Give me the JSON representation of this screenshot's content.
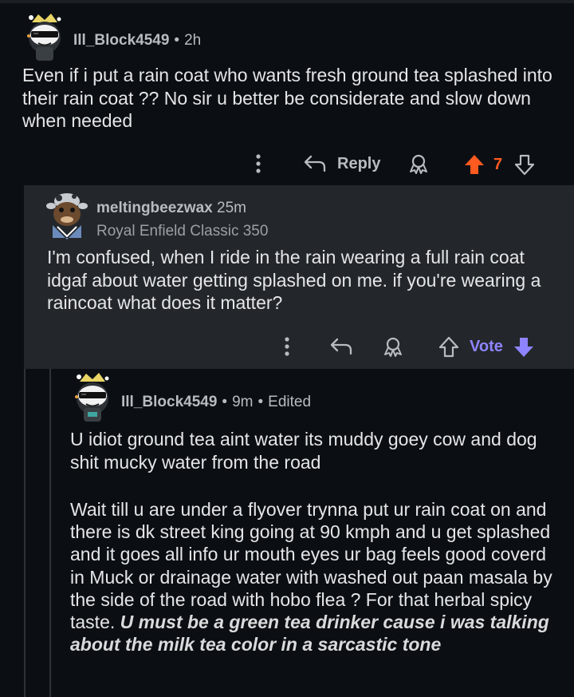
{
  "comments": [
    {
      "username": "Ill_Block4549",
      "time": "2h",
      "body": "Even if i put a rain coat who wants fresh ground tea splashed into their rain coat ?? No sir u better be considerate and slow down when needed",
      "actions": {
        "reply_label": "Reply",
        "score": "7"
      },
      "colors": {
        "upvote_active": "#ff5a1f"
      }
    },
    {
      "username": "meltingbeezwax",
      "time": "25m",
      "flair": "Royal Enfield Classic 350",
      "body": "I'm confused, when I ride in the rain wearing a full rain coat idgaf about water getting splashed on me. if you're wearing a raincoat what does it matter?",
      "actions": {
        "vote_label": "Vote"
      },
      "colors": {
        "vote_accent": "#8e84ff"
      }
    },
    {
      "username": "Ill_Block4549",
      "time": "9m",
      "edited": "Edited",
      "p1": "U idiot ground tea aint water its muddy goey cow and dog shit mucky water from the road",
      "p2_plain": "Wait till u are under a flyover trynna put ur rain coat on and there is dk street king going at 90 kmph and u get splashed and it goes all info ur mouth eyes ur bag feels good coverd in Muck or drainage water with washed out paan masala by the side of the road with hobo flea ? For that herbal spicy taste. ",
      "p2_bold": "U must be a green tea drinker cause i was talking about the milk tea color in a sarcastic tone"
    }
  ],
  "icons": [
    "snoo-sunglasses-avatar-icon",
    "snoo-cow-avatar-icon",
    "more-options-icon",
    "reply-arrow-icon",
    "award-icon",
    "upvote-icon",
    "downvote-icon"
  ]
}
